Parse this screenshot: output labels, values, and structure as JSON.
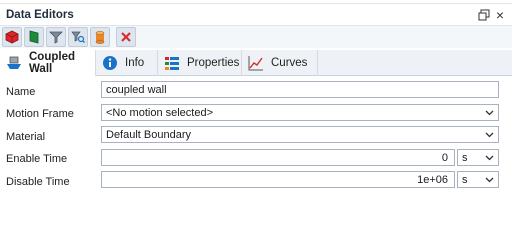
{
  "panel": {
    "title": "Data Editors"
  },
  "toolbar": {
    "buttons": [
      {
        "icon": "red-cube-icon"
      },
      {
        "icon": "green-flag-icon"
      },
      {
        "icon": "filter-icon"
      },
      {
        "icon": "search-filter-icon"
      },
      {
        "icon": "cylinder-icon"
      },
      {
        "icon": "delete-icon"
      }
    ]
  },
  "tabs": [
    {
      "label": "Coupled Wall",
      "active": true
    },
    {
      "label": "Info"
    },
    {
      "label": "Properties"
    },
    {
      "label": "Curves"
    }
  ],
  "form": {
    "name": {
      "label": "Name",
      "value": "coupled wall"
    },
    "motion_frame": {
      "label": "Motion Frame",
      "value": "<No motion selected>"
    },
    "material": {
      "label": "Material",
      "value": "Default Boundary"
    },
    "enable_time": {
      "label": "Enable Time",
      "value": "0",
      "unit": "s"
    },
    "disable_time": {
      "label": "Disable Time",
      "value": "1e+06",
      "unit": "s"
    }
  },
  "colors": {
    "accent": "#1a73c8",
    "delete": "#d32f2f",
    "cube": "#d8262c",
    "flag": "#1e8a3c",
    "cylinder": "#e8872a"
  }
}
